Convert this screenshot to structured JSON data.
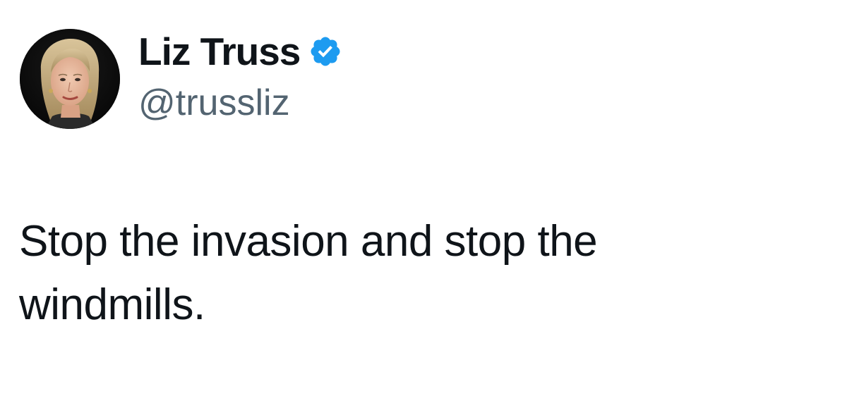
{
  "author": {
    "display_name": "Liz Truss",
    "handle": "@trussliz",
    "verified": true,
    "verified_icon": "verified-badge-icon",
    "avatar": "profile-photo"
  },
  "tweet": {
    "text_line_1": "Stop the invasion and stop the",
    "text_line_2": "windmills."
  },
  "colors": {
    "background": "#ffffff",
    "text_primary": "#0f1419",
    "text_secondary": "#536471",
    "verified_blue": "#1d9bf0"
  }
}
